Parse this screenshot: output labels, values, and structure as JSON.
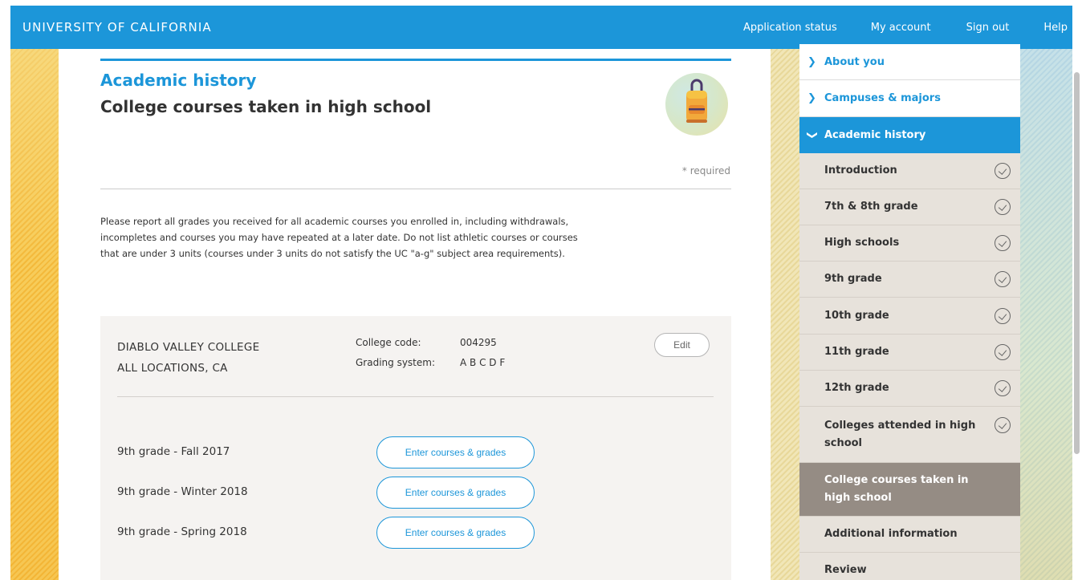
{
  "header": {
    "brand": "UNIVERSITY OF CALIFORNIA",
    "nav": {
      "application_status": "Application status",
      "my_account": "My account",
      "sign_out": "Sign out",
      "help": "Help"
    }
  },
  "main": {
    "section_title": "Academic history",
    "page_title": "College courses taken in high school",
    "illustration_icon": "backpack-icon",
    "required_note": "* required",
    "intro": "Please report all grades you received for all academic courses you enrolled in, including withdrawals, incompletes and courses you may have repeated at a later date. Do not list athletic courses or courses that are under 3 units (courses under 3 units do not satisfy the UC \"a-g\" subject area requirements).",
    "college": {
      "name": "DIABLO VALLEY COLLEGE",
      "location": "ALL LOCATIONS, CA",
      "code_label": "College code:",
      "code_value": "004295",
      "grading_label": "Grading system:",
      "grading_value": "A B C D F",
      "edit_label": "Edit"
    },
    "terms": [
      {
        "label": "9th grade - Fall 2017",
        "button": "Enter courses & grades"
      },
      {
        "label": "9th grade - Winter 2018",
        "button": "Enter courses & grades"
      },
      {
        "label": "9th grade - Spring 2018",
        "button": "Enter courses & grades"
      }
    ]
  },
  "sidebar": {
    "top_items": [
      {
        "label": "About you",
        "icon": "chevron-right-icon"
      },
      {
        "label": "Campuses & majors",
        "icon": "chevron-right-icon"
      },
      {
        "label": "Academic history",
        "icon": "chevron-down-icon"
      }
    ],
    "sub_items": [
      {
        "label": "Introduction",
        "completed": true
      },
      {
        "label": "7th & 8th grade",
        "completed": true
      },
      {
        "label": "High schools",
        "completed": true
      },
      {
        "label": "9th grade",
        "completed": true
      },
      {
        "label": "10th grade",
        "completed": true
      },
      {
        "label": "11th grade",
        "completed": true
      },
      {
        "label": "12th grade",
        "completed": true
      },
      {
        "label": "Colleges attended in high school",
        "completed": true
      },
      {
        "label": "College courses taken in high school",
        "completed": false,
        "current": true
      },
      {
        "label": "Additional information",
        "completed": false
      },
      {
        "label": "Review",
        "completed": false
      }
    ]
  },
  "colors": {
    "brand_blue": "#1c96d9",
    "current_item": "#958c84",
    "sub_item_bg": "#e7e2db",
    "card_bg": "#f5f3f1"
  }
}
